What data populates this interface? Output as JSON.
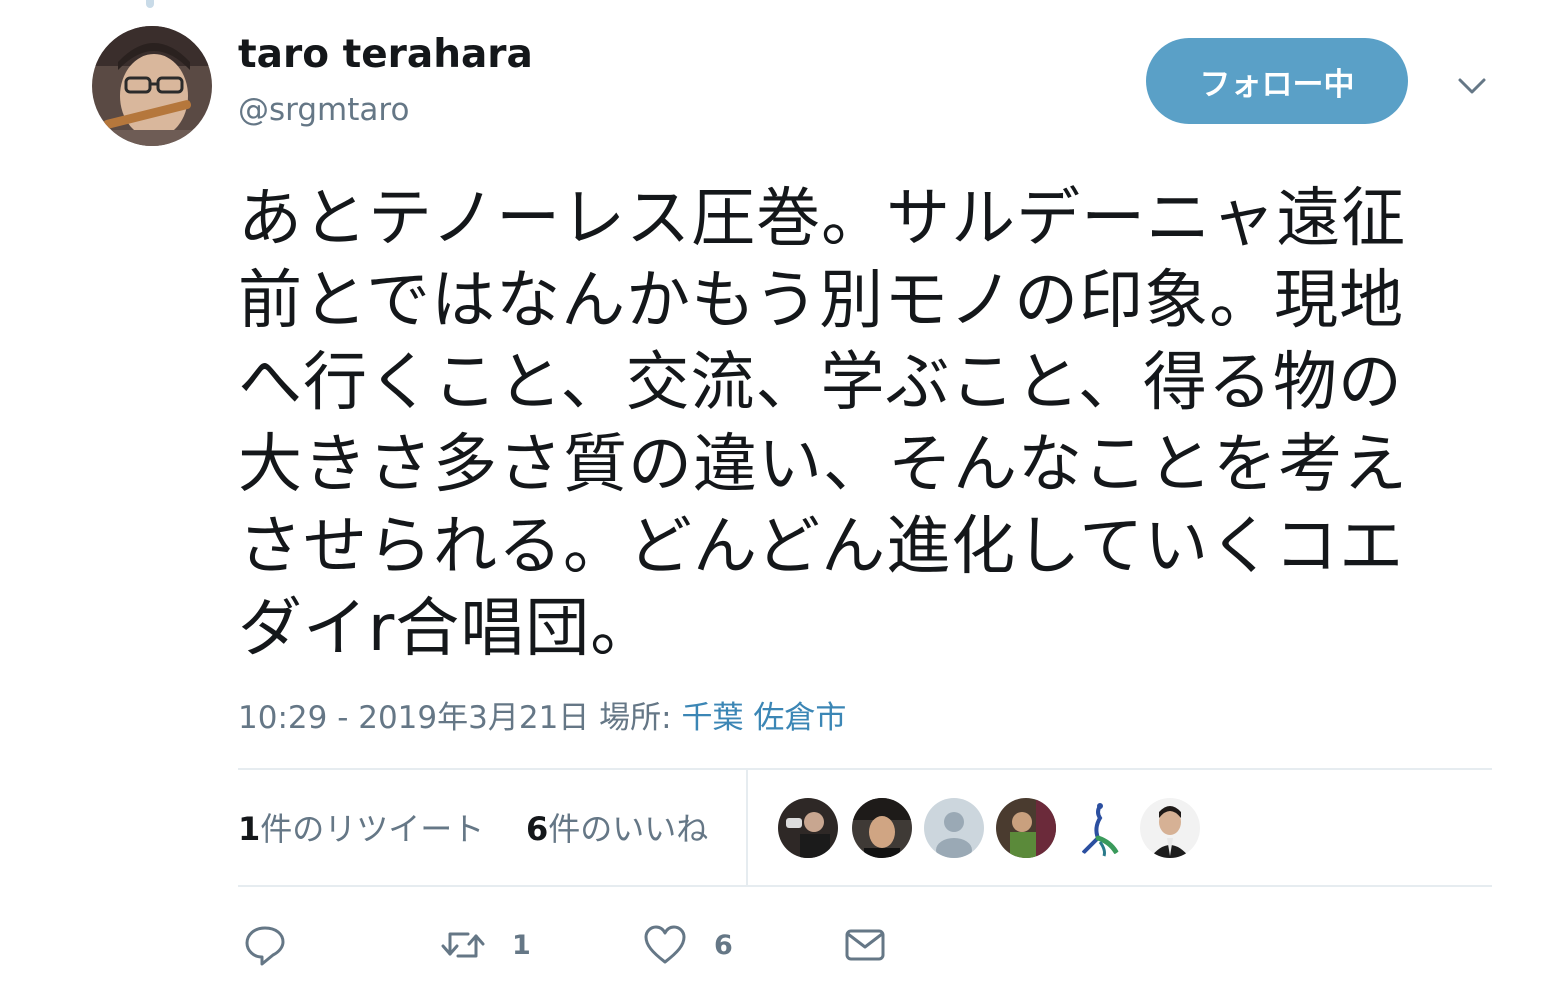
{
  "user": {
    "display_name": "taro terahara",
    "handle": "@srgmtaro"
  },
  "follow_button": {
    "label": "フォロー中"
  },
  "tweet": {
    "lines": [
      "あとテノーレス圧巻。サルデーニャ遠征",
      "前とではなんかもう別モノの印象。現地",
      "へ行くこと、交流、学ぶこと、得る物の",
      "大きさ多さ質の違い、そんなことを考え",
      "させられる。どんどん進化していくコエ",
      "ダイr合唱団。"
    ]
  },
  "meta": {
    "time": "10:29 - 2019年3月21日",
    "place_label": "場所:",
    "place": "千葉 佐倉市"
  },
  "stats": {
    "retweets_count": "1",
    "retweets_label": "件のリツイート",
    "likes_count": "6",
    "likes_label": "件のいいね"
  },
  "likers": [
    {
      "name": "liker-avatar-1"
    },
    {
      "name": "liker-avatar-2"
    },
    {
      "name": "liker-avatar-3-default"
    },
    {
      "name": "liker-avatar-4"
    },
    {
      "name": "liker-avatar-5-peacock"
    },
    {
      "name": "liker-avatar-6"
    }
  ],
  "actions": {
    "reply_icon": "reply-icon",
    "retweet_icon": "retweet-icon",
    "retweet_count": "1",
    "like_icon": "heart-icon",
    "like_count": "6",
    "dm_icon": "envelope-icon"
  },
  "colors": {
    "follow_button": "#5aa0c7",
    "link": "#3b86b5",
    "secondary_text": "#657786",
    "divider": "#e6ecf0"
  }
}
